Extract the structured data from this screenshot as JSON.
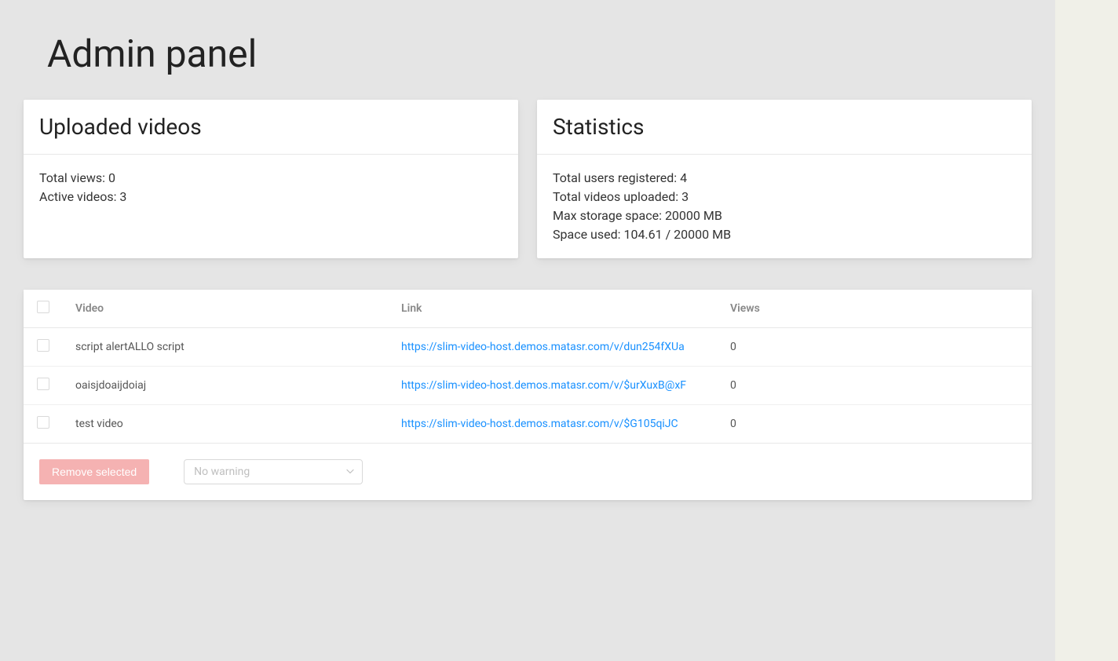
{
  "page": {
    "title": "Admin panel"
  },
  "uploaded_videos_card": {
    "title": "Uploaded videos",
    "total_views_label": "Total views:",
    "total_views_value": "0",
    "active_videos_label": "Active videos:",
    "active_videos_value": "3"
  },
  "statistics_card": {
    "title": "Statistics",
    "total_users_label": "Total users registered:",
    "total_users_value": "4",
    "total_videos_label": "Total videos uploaded:",
    "total_videos_value": "3",
    "max_storage_label": "Max storage space:",
    "max_storage_value": "20000 MB",
    "space_used_label": "Space used:",
    "space_used_value": "104.61 / 20000 MB"
  },
  "table": {
    "headers": {
      "video": "Video",
      "link": "Link",
      "views": "Views"
    },
    "rows": [
      {
        "video": "script alertALLO script",
        "link": "https://slim-video-host.demos.matasr.com/v/dun254fXUa",
        "views": "0"
      },
      {
        "video": "oaisjdoaijdoiaj",
        "link": "https://slim-video-host.demos.matasr.com/v/$urXuxB@xF",
        "views": "0"
      },
      {
        "video": "test video",
        "link": "https://slim-video-host.demos.matasr.com/v/$G105qiJC",
        "views": "0"
      }
    ]
  },
  "actions": {
    "remove_label": "Remove selected",
    "warning_select_placeholder": "No warning"
  }
}
